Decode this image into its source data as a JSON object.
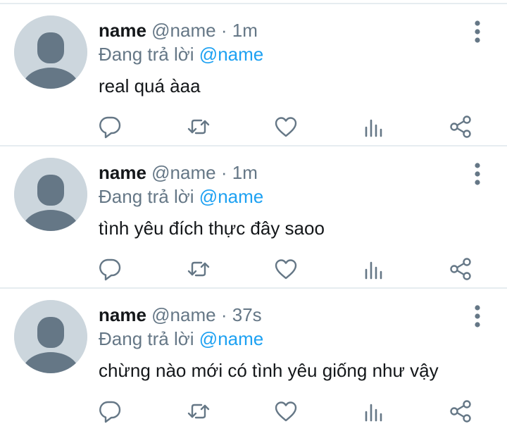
{
  "tweets": [
    {
      "name": "name",
      "handle": "@name",
      "separator": "·",
      "time": "1m",
      "reply_prefix": "Đang trả lời",
      "reply_to": "@name",
      "text": "real quá àaa"
    },
    {
      "name": "name",
      "handle": "@name",
      "separator": "·",
      "time": "1m",
      "reply_prefix": "Đang trả lời",
      "reply_to": "@name",
      "text": "tình yêu đích thực đây saoo"
    },
    {
      "name": "name",
      "handle": "@name",
      "separator": "·",
      "time": "37s",
      "reply_prefix": "Đang trả lời",
      "reply_to": "@name",
      "text": "chừng nào mới có tình yêu giống như vậy"
    }
  ],
  "icons": {
    "reply": "reply-icon",
    "retweet": "retweet-icon",
    "like": "heart-icon",
    "analytics": "analytics-icon",
    "share": "share-icon",
    "more": "more-vertical-icon"
  },
  "colors": {
    "text": "#14171a",
    "secondary": "#657786",
    "accent": "#1da1f2",
    "avatar_bg": "#ccd6dd",
    "avatar_fg": "#657786",
    "divider": "#e6ecf0"
  }
}
